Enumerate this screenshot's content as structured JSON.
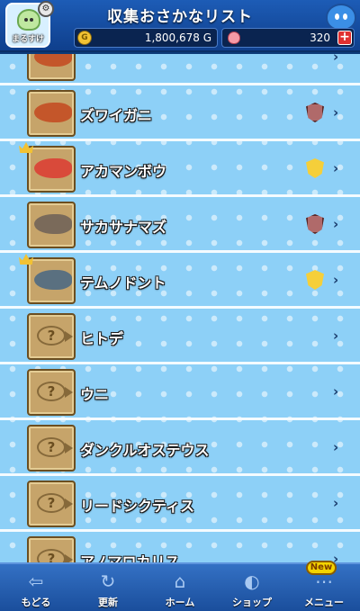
{
  "header": {
    "title": "収集おさかなリスト",
    "avatar_name": "まるすけ",
    "gold_value": "1,800,678 G",
    "gem_value": "320",
    "coin_symbol": "G",
    "add_symbol": "+"
  },
  "list": {
    "items": [
      {
        "name": "",
        "status": "unlocked",
        "crown": false,
        "medal": null
      },
      {
        "name": "ズワイガニ",
        "status": "unlocked",
        "crown": false,
        "medal": "bronze"
      },
      {
        "name": "アカマンボウ",
        "status": "unlocked",
        "crown": true,
        "medal": "gold"
      },
      {
        "name": "サカサナマズ",
        "status": "unlocked",
        "crown": false,
        "medal": "bronze"
      },
      {
        "name": "テムノドント",
        "status": "unlocked",
        "crown": true,
        "medal": "gold"
      },
      {
        "name": "ヒトデ",
        "status": "locked",
        "crown": false,
        "medal": null
      },
      {
        "name": "ウニ",
        "status": "locked",
        "crown": false,
        "medal": null
      },
      {
        "name": "ダンクルオステウス",
        "status": "locked",
        "crown": false,
        "medal": null
      },
      {
        "name": "リードシクティス",
        "status": "locked",
        "crown": false,
        "medal": null
      },
      {
        "name": "アノマロカリス",
        "status": "locked",
        "crown": false,
        "medal": null
      }
    ],
    "locked_symbol": "?",
    "chevron": "›"
  },
  "tabbar": {
    "tabs": [
      {
        "label": "もどる",
        "icon": "back-arrow-icon"
      },
      {
        "label": "更新",
        "icon": "refresh-icon"
      },
      {
        "label": "ホーム",
        "icon": "home-dragon-icon"
      },
      {
        "label": "ショップ",
        "icon": "shop-slime-icon"
      },
      {
        "label": "メニュー",
        "icon": "menu-dots-icon"
      }
    ],
    "new_badge": "New"
  },
  "colors": {
    "header": "#1d5cb6",
    "list_background": "#8dd0f7",
    "thumb": "#c6a46a",
    "tabbar": "#2a64b4",
    "medal_gold": "#f5cf3a",
    "medal_bronze": "#b06a6a"
  }
}
